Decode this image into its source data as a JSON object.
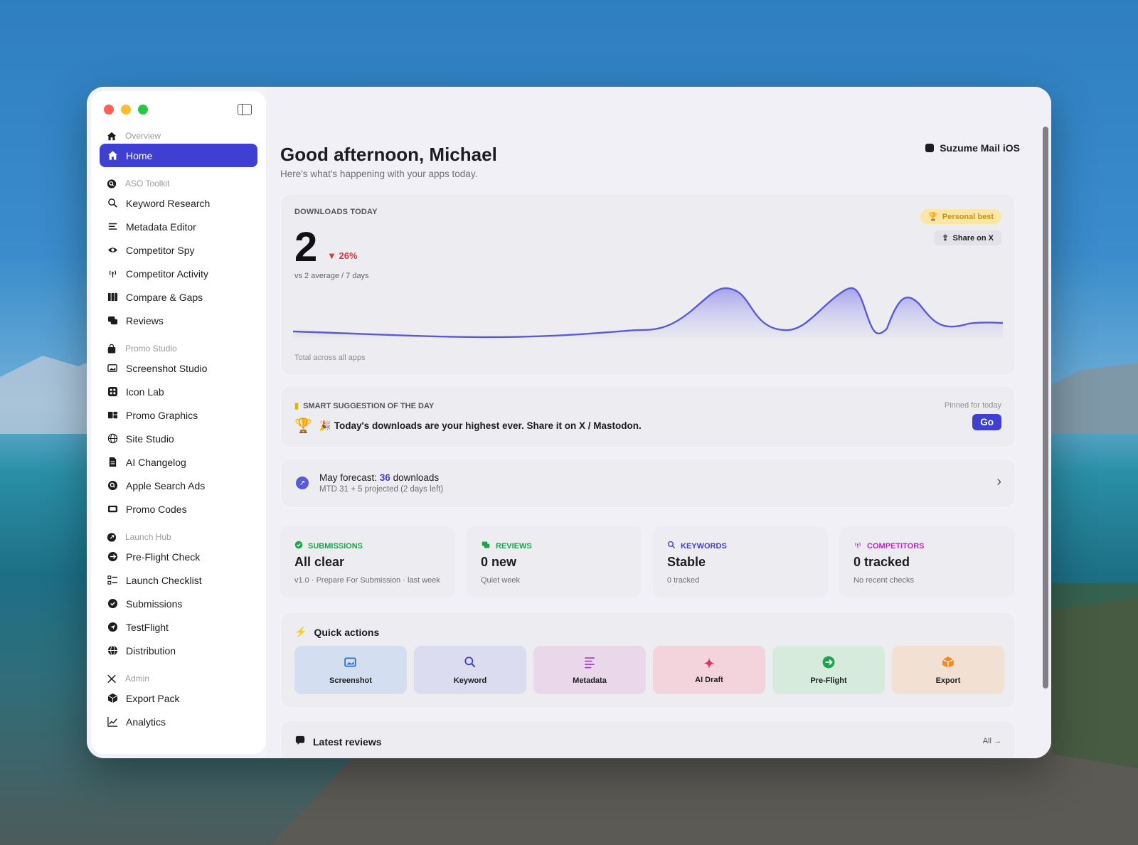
{
  "sidebar": {
    "sections": [
      {
        "label": "Overview",
        "icon": "house-icon",
        "items": [
          {
            "label": "Home",
            "icon": "house-icon",
            "active": true
          }
        ]
      },
      {
        "label": "ASO Toolkit",
        "icon": "magnifier-circle-icon",
        "items": [
          {
            "label": "Keyword Research",
            "icon": "magnifier-icon"
          },
          {
            "label": "Metadata Editor",
            "icon": "text-lines-icon"
          },
          {
            "label": "Competitor Spy",
            "icon": "eye-icon"
          },
          {
            "label": "Competitor Activity",
            "icon": "antenna-icon"
          },
          {
            "label": "Compare & Gaps",
            "icon": "columns-icon"
          },
          {
            "label": "Reviews",
            "icon": "chat-bubbles-icon"
          }
        ]
      },
      {
        "label": "Promo Studio",
        "icon": "bag-icon",
        "items": [
          {
            "label": "Screenshot Studio",
            "icon": "photo-stack-icon"
          },
          {
            "label": "Icon Lab",
            "icon": "app-grid-icon"
          },
          {
            "label": "Promo Graphics",
            "icon": "blocks-icon"
          },
          {
            "label": "Site Studio",
            "icon": "globe-icon"
          },
          {
            "label": "AI Changelog",
            "icon": "document-icon"
          },
          {
            "label": "Apple Search Ads",
            "icon": "search-circle-icon"
          },
          {
            "label": "Promo Codes",
            "icon": "ticket-icon"
          }
        ]
      },
      {
        "label": "Launch Hub",
        "icon": "rocket-icon",
        "items": [
          {
            "label": "Pre-Flight Check",
            "icon": "airplane-circle-icon"
          },
          {
            "label": "Launch Checklist",
            "icon": "checklist-icon"
          },
          {
            "label": "Submissions",
            "icon": "checkmark-seal-icon"
          },
          {
            "label": "TestFlight",
            "icon": "paperplane-circle-icon"
          },
          {
            "label": "Distribution",
            "icon": "globe-fill-icon"
          }
        ]
      },
      {
        "label": "Admin",
        "icon": "wrench-icon",
        "items": [
          {
            "label": "Export Pack",
            "icon": "box-icon"
          },
          {
            "label": "Analytics",
            "icon": "line-chart-icon"
          }
        ]
      }
    ]
  },
  "header": {
    "greeting": "Good afternoon, Michael",
    "subtitle": "Here's what's happening with your apps today.",
    "app_name": "Suzume Mail iOS"
  },
  "downloads": {
    "caption": "DOWNLOADS TODAY",
    "value": "2",
    "delta": "▼ 26%",
    "comparison": "vs 2 average / 7 days",
    "footer": "Total across all apps",
    "badge": "Personal best",
    "share_label": "Share on X",
    "colors": {
      "line": "#5a5ad8",
      "fill": "#a9a6ef"
    }
  },
  "suggestion": {
    "caption": "SMART SUGGESTION OF THE DAY",
    "pinned": "Pinned for today",
    "emoji": "🎉",
    "text": "Today's downloads are your highest ever. Share it on X / Mastodon.",
    "button": "Go"
  },
  "forecast": {
    "prefix": "May forecast:",
    "value": "36",
    "suffix": "downloads",
    "detail": "MTD 31 + 5 projected (2 days left)"
  },
  "stats": [
    {
      "caption": "SUBMISSIONS",
      "value": "All clear",
      "sub": "v1.0 · Prepare For Submission · last week",
      "color": "#1fa34a",
      "icon": "checkmark-seal-icon"
    },
    {
      "caption": "REVIEWS",
      "value": "0 new",
      "sub": "Quiet week",
      "color": "#1fa34a",
      "icon": "chat-bubbles-icon"
    },
    {
      "caption": "KEYWORDS",
      "value": "Stable",
      "sub": "0 tracked",
      "color": "#3f3fd1",
      "icon": "magnifier-icon"
    },
    {
      "caption": "COMPETITORS",
      "value": "0 tracked",
      "sub": "No recent checks",
      "color": "#b02fc4",
      "icon": "antenna-icon"
    }
  ],
  "quick_actions": {
    "title": "Quick actions",
    "items": [
      {
        "label": "Screenshot",
        "icon": "photo-stack-icon",
        "glyph": "🖼",
        "bg": "#d3dff0"
      },
      {
        "label": "Keyword",
        "icon": "magnifier-icon",
        "glyph": "⌕",
        "bg": "#dcdcf0"
      },
      {
        "label": "Metadata",
        "icon": "text-lines-icon",
        "glyph": "☰",
        "bg": "#ead7ea"
      },
      {
        "label": "AI Draft",
        "icon": "sparkles-icon",
        "glyph": "✦",
        "bg": "#f3d3dc"
      },
      {
        "label": "Pre-Flight",
        "icon": "airplane-circle-icon",
        "glyph": "✈",
        "bg": "#d6ebdb"
      },
      {
        "label": "Export",
        "icon": "box-icon",
        "glyph": "📦",
        "bg": "#f2e1d3"
      }
    ]
  },
  "latest_reviews": {
    "title": "Latest reviews",
    "all_link": "All →"
  }
}
